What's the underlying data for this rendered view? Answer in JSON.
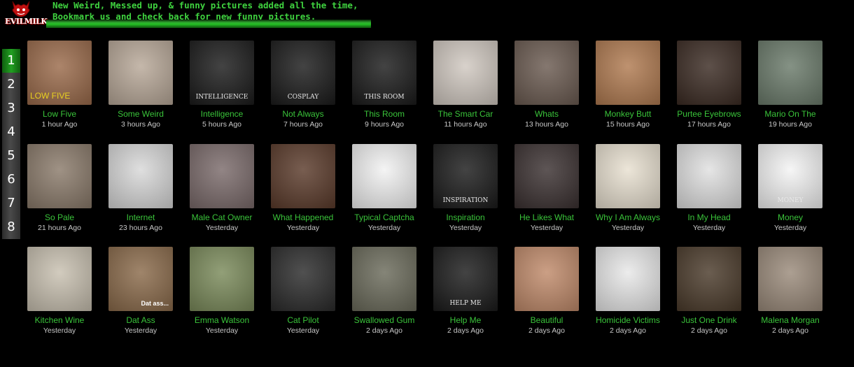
{
  "site": {
    "logo_text": "EVILMILK",
    "tagline_line1": "New Weird, Messed up, & funny pictures added all the time,",
    "tagline_line2": "Bookmark us and check back for new funny pictures."
  },
  "pagination": {
    "pages": [
      "1",
      "2",
      "3",
      "4",
      "5",
      "6",
      "7",
      "8"
    ],
    "current": "1"
  },
  "thumbnails": [
    {
      "title": "Low Five",
      "time": "1 hour Ago",
      "caption": "LOW FIVE",
      "bg": "#9a6a4a"
    },
    {
      "title": "Some Weird",
      "time": "3 hours Ago",
      "caption": "",
      "bg": "#b8a898"
    },
    {
      "title": "Intelligence",
      "time": "5 hours Ago",
      "caption": "INTELLIGENCE",
      "bg": "#1a1a1a"
    },
    {
      "title": "Not Always",
      "time": "7 hours Ago",
      "caption": "COSPLAY",
      "bg": "#1a1a1a"
    },
    {
      "title": "This Room",
      "time": "9 hours Ago",
      "caption": "THIS ROOM",
      "bg": "#1a1a1a"
    },
    {
      "title": "The Smart Car",
      "time": "11 hours Ago",
      "caption": "",
      "bg": "#d0c8c0"
    },
    {
      "title": "Whats",
      "time": "13 hours Ago",
      "caption": "",
      "bg": "#6a5a50"
    },
    {
      "title": "Monkey Butt",
      "time": "15 hours Ago",
      "caption": "",
      "bg": "#b07a50"
    },
    {
      "title": "Purtee Eyebrows",
      "time": "17 hours Ago",
      "caption": "",
      "bg": "#3a2a22"
    },
    {
      "title": "Mario On The",
      "time": "19 hours Ago",
      "caption": "",
      "bg": "#6a7a6a"
    },
    {
      "title": "So Pale",
      "time": "21 hours Ago",
      "caption": "",
      "bg": "#8a7a6a"
    },
    {
      "title": "Internet",
      "time": "23 hours Ago",
      "caption": "",
      "bg": "#d8d8d8"
    },
    {
      "title": "Male Cat Owner",
      "time": "Yesterday",
      "caption": "",
      "bg": "#7a6a6a"
    },
    {
      "title": "What Happened",
      "time": "Yesterday",
      "caption": "",
      "bg": "#5a3a2a"
    },
    {
      "title": "Typical Captcha",
      "time": "Yesterday",
      "caption": "",
      "bg": "#f2f2f2"
    },
    {
      "title": "Inspiration",
      "time": "Yesterday",
      "caption": "INSPIRATION",
      "bg": "#1a1a1a"
    },
    {
      "title": "He Likes What",
      "time": "Yesterday",
      "caption": "",
      "bg": "#3a3030"
    },
    {
      "title": "Why I Am Always",
      "time": "Yesterday",
      "caption": "",
      "bg": "#e8e0d0"
    },
    {
      "title": "In My Head",
      "time": "Yesterday",
      "caption": "",
      "bg": "#e0e0e0"
    },
    {
      "title": "Money",
      "time": "Yesterday",
      "caption": "MONEY",
      "bg": "#f4f4f4"
    },
    {
      "title": "Kitchen Wine",
      "time": "Yesterday",
      "caption": "",
      "bg": "#c8c0b0"
    },
    {
      "title": "Dat Ass",
      "time": "Yesterday",
      "caption": "Dat ass...",
      "bg": "#8a6a4a"
    },
    {
      "title": "Emma Watson",
      "time": "Yesterday",
      "caption": "",
      "bg": "#7a8a5a"
    },
    {
      "title": "Cat Pilot",
      "time": "Yesterday",
      "caption": "",
      "bg": "#2a2a2a"
    },
    {
      "title": "Swallowed Gum",
      "time": "2 days Ago",
      "caption": "",
      "bg": "#6a6a5a"
    },
    {
      "title": "Help Me",
      "time": "2 days Ago",
      "caption": "HELP ME",
      "bg": "#1a1a1a"
    },
    {
      "title": "Beautiful",
      "time": "2 days Ago",
      "caption": "",
      "bg": "#c08a6a"
    },
    {
      "title": "Homicide Victims",
      "time": "2 days Ago",
      "caption": "",
      "bg": "#e8e8e8"
    },
    {
      "title": "Just One Drink",
      "time": "2 days Ago",
      "caption": "",
      "bg": "#4a3a2a"
    },
    {
      "title": "Malena Morgan",
      "time": "2 days Ago",
      "caption": "",
      "bg": "#9a8a7a"
    }
  ],
  "colors": {
    "link_green": "#3ac43a",
    "tagline_green": "#3fd23f",
    "active_page": "#22a022",
    "background": "#000000"
  }
}
